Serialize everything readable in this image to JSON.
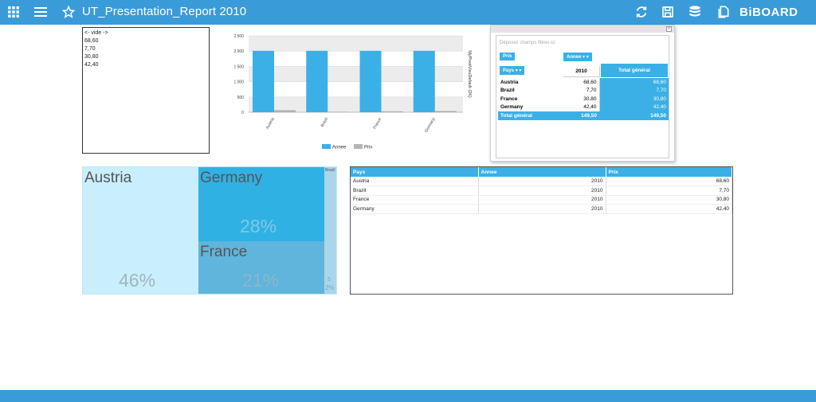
{
  "header": {
    "title": "UT_Presentation_Report 2010",
    "brand": "BiBOARD"
  },
  "listbox": {
    "items": [
      "<- vide ->",
      "68,60",
      "7,70",
      "30,80",
      "42,40"
    ]
  },
  "chart_data": {
    "type": "bar",
    "categories": [
      "Austria",
      "Brazil",
      "France",
      "Germany"
    ],
    "series": [
      {
        "name": "Annee",
        "values": [
          2010,
          2010,
          2010,
          2010
        ],
        "color": "#3ab0e6"
      },
      {
        "name": "Prix",
        "values": [
          68.6,
          7.7,
          30.8,
          42.4
        ],
        "color": "#b5b5b5"
      }
    ],
    "yticks": [
      "0",
      "500",
      "1 000",
      "1 500",
      "2 000",
      "2 500"
    ],
    "ylim": [
      0,
      2500
    ],
    "y2label": "MyPivotVisuDefault (2K)",
    "legend": [
      "Annee",
      "Prix"
    ],
    "legend_position": "bottom"
  },
  "pivot": {
    "drop_hint": "Déposez champs filtres ici",
    "data_chip": "Prix",
    "col_chip": "Annee",
    "row_chip": "Pays",
    "col_header": "2010",
    "total_header": "Total général",
    "rows": [
      {
        "label": "Austria",
        "value": "68,60",
        "total": "68,60"
      },
      {
        "label": "Brazil",
        "value": "7,70",
        "total": "7,70"
      },
      {
        "label": "France",
        "value": "30,80",
        "total": "30,80"
      },
      {
        "label": "Germany",
        "value": "42,40",
        "total": "42,40"
      }
    ],
    "grand": {
      "label": "Total général",
      "value": "149,50",
      "total": "149,50"
    }
  },
  "treemap": {
    "cells": [
      {
        "label": "Austria",
        "pct": "46%",
        "color": "#c9eefd"
      },
      {
        "label": "Germany",
        "pct": "28%",
        "color": "#2fb1e3"
      },
      {
        "label": "France",
        "pct": "21%",
        "color": "#5fb5db"
      },
      {
        "label": "Brazil",
        "pct": "2%",
        "extra": "5",
        "color": "#a9d6ea"
      }
    ]
  },
  "grid": {
    "columns": [
      "Pays",
      "Annee",
      "Prix"
    ],
    "rows": [
      [
        "Austria",
        "2010",
        "68,60"
      ],
      [
        "Brazil",
        "2010",
        "7,70"
      ],
      [
        "France",
        "2010",
        "30,80"
      ],
      [
        "Germany",
        "2010",
        "42,40"
      ]
    ]
  },
  "colors": {
    "accent": "#3a9bd9",
    "chip": "#3ab0e6"
  }
}
